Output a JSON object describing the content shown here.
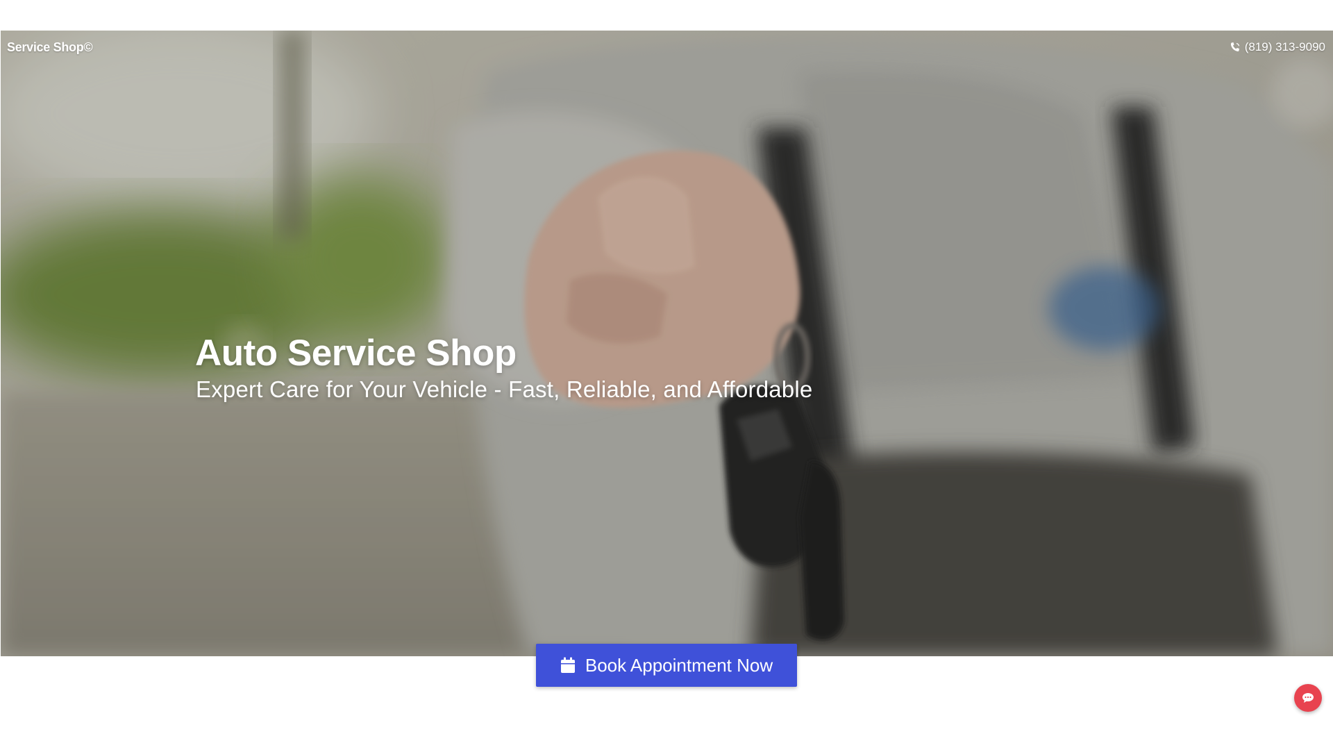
{
  "header": {
    "brand": "Service Shop©",
    "phone_icon": "phone-icon",
    "phone": "(819) 313-9090"
  },
  "hero": {
    "title": "Auto Service Shop",
    "subtitle": "Expert Care for Your Vehicle - Fast, Reliable, and Affordable",
    "image": "blurred photo of a mechanic handing over car keys"
  },
  "cta": {
    "icon": "calendar-icon",
    "label": "Book Appointment Now"
  },
  "chat": {
    "icon": "chat-bubble-icon"
  },
  "colors": {
    "cta_bg": "#3f51d9",
    "chat_bg": "#e8434f",
    "text_on_image": "#ffffff"
  }
}
